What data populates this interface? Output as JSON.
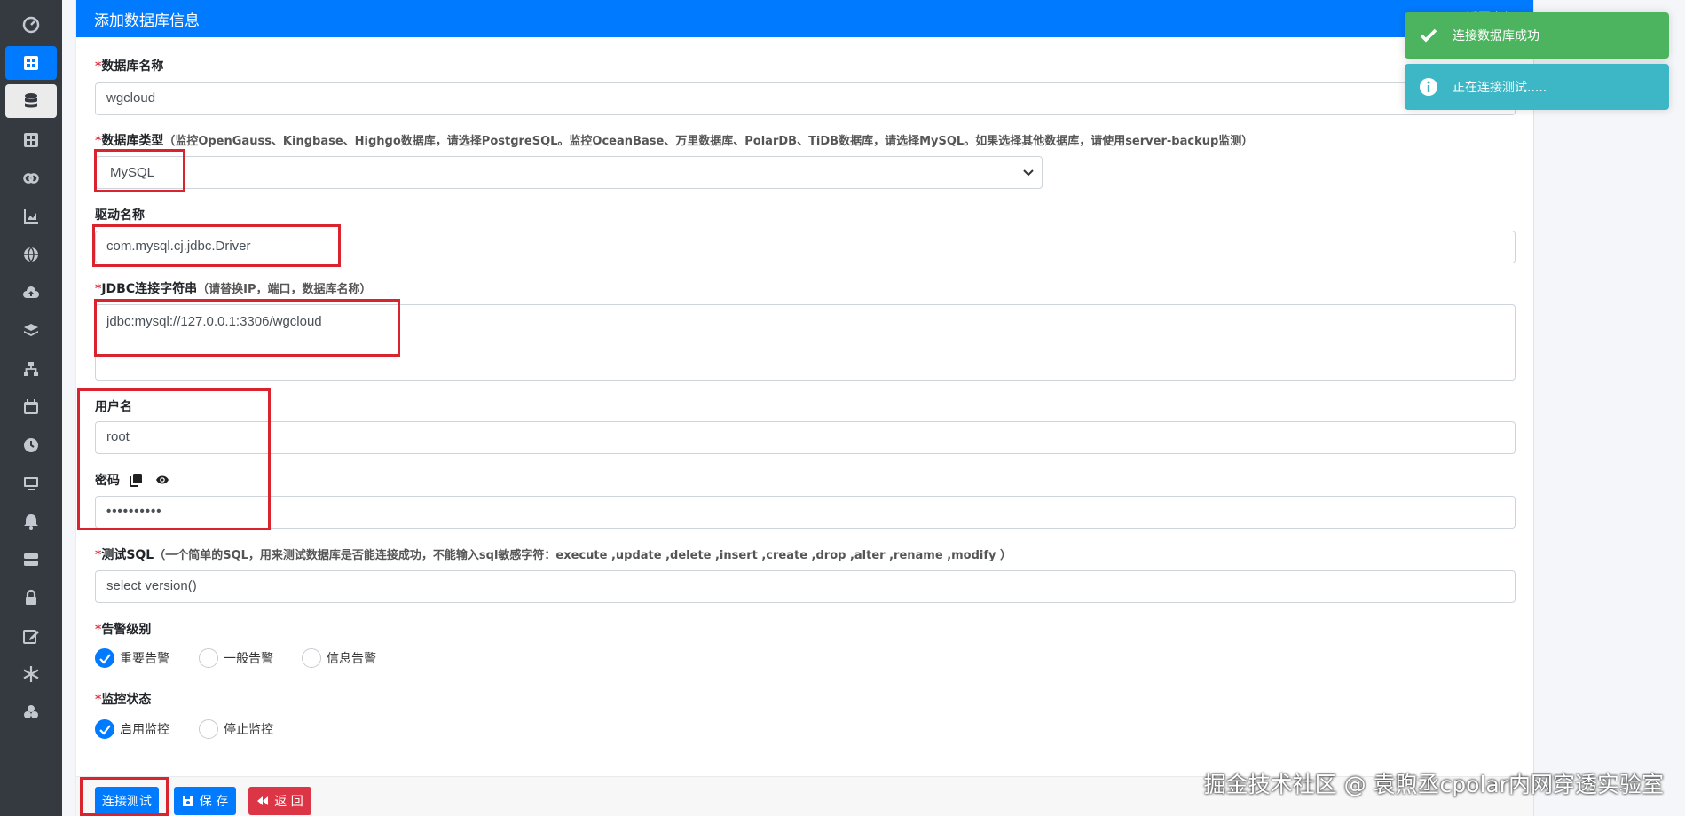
{
  "header": {
    "title": "添加数据库信息",
    "back_link": "返回上级"
  },
  "form": {
    "db_name": {
      "label": "数据库名称",
      "value": "wgcloud"
    },
    "db_type": {
      "label": "数据库类型",
      "hint": "（监控OpenGauss、Kingbase、Highgo数据库，请选择PostgreSQL。监控OceanBase、万里数据库、PolarDB、TiDB数据库，请选择MySQL。如果选择其他数据库，请使用server-backup监测）",
      "selected": "MySQL"
    },
    "driver": {
      "label": "驱动名称",
      "value": "com.mysql.cj.jdbc.Driver"
    },
    "jdbc": {
      "label": "JDBC连接字符串",
      "hint": "（请替换IP，端口，数据库名称）",
      "value": "jdbc:mysql://127.0.0.1:3306/wgcloud"
    },
    "username": {
      "label": "用户名",
      "value": "root"
    },
    "password": {
      "label": "密码",
      "value": "••••••••••"
    },
    "test_sql": {
      "label": "测试SQL",
      "hint": "（一个简单的SQL，用来测试数据库是否能连接成功，不能输入sql敏感字符：execute ,update ,delete ,insert ,create ,drop ,alter ,rename ,modify ）",
      "value": "select version()"
    },
    "alarm_level": {
      "label": "告警级别",
      "options": [
        "重要告警",
        "一般告警",
        "信息告警"
      ],
      "selected": "重要告警"
    },
    "monitor_status": {
      "label": "监控状态",
      "options": [
        "启用监控",
        "停止监控"
      ],
      "selected": "启用监控"
    }
  },
  "buttons": {
    "test": "连接测试",
    "save": "保 存",
    "back": "返 回"
  },
  "toasts": {
    "success": "连接数据库成功",
    "info": "正在连接测试....."
  },
  "watermark": "掘金技术社区 @ 袁煦丞cpolar内网穿透实验室",
  "colors": {
    "primary": "#007bff",
    "success": "#4cb45e",
    "info": "#3db6c6",
    "danger": "#dc3545",
    "highlight_box": "#d9232e"
  }
}
